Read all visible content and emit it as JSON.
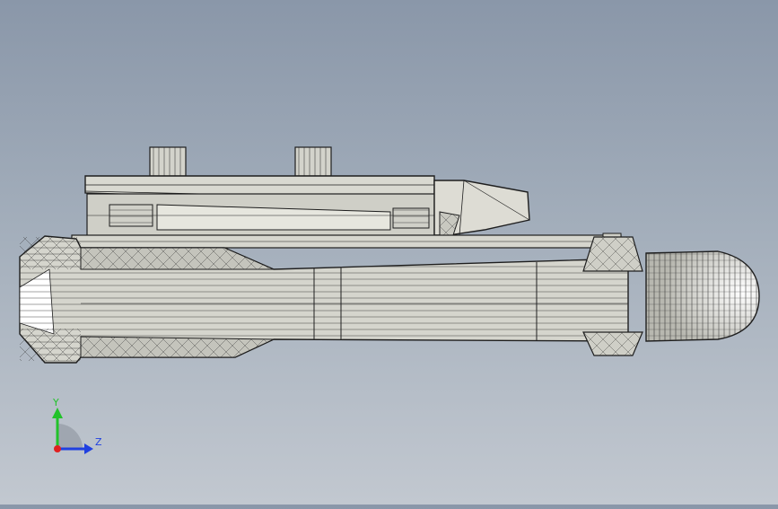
{
  "viewport": {
    "background_top": "#8a97a9",
    "background_bottom": "#c2c8d0",
    "model_fill": "#d8d8d0",
    "edge_color": "#1e1e1e"
  },
  "triad": {
    "y_label": "Y",
    "z_label": "Z",
    "y_color": "#22c22a",
    "z_color": "#2040e0",
    "x_color": "#e02020"
  }
}
